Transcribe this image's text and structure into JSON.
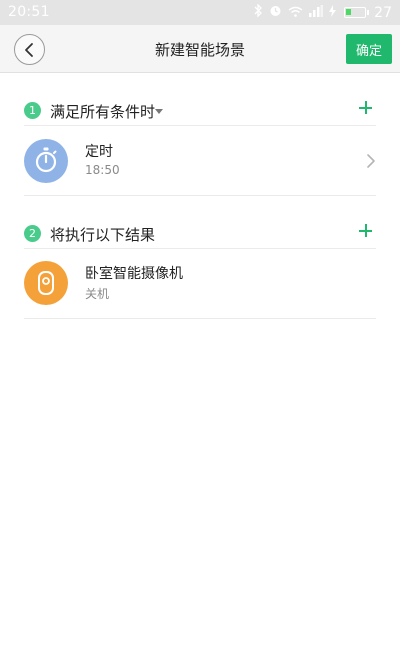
{
  "status_bar": {
    "time": "20:51",
    "battery": "27",
    "battery_level": 0.27
  },
  "header": {
    "title": "新建智能场景",
    "confirm_label": "确定"
  },
  "sections": [
    {
      "step": "1",
      "title": "满足所有条件时",
      "has_dropdown": true,
      "items": [
        {
          "title": "定时",
          "subtitle": "18:50",
          "icon": "stopwatch-icon",
          "icon_color": "#8fb3e6"
        }
      ]
    },
    {
      "step": "2",
      "title": "将执行以下结果",
      "has_dropdown": false,
      "items": [
        {
          "title": "卧室智能摄像机",
          "subtitle": "关机",
          "icon": "camera-icon",
          "icon_color": "#f5a13a"
        }
      ]
    }
  ],
  "colors": {
    "accent": "#1fb86d",
    "badge": "#49cc8b"
  }
}
